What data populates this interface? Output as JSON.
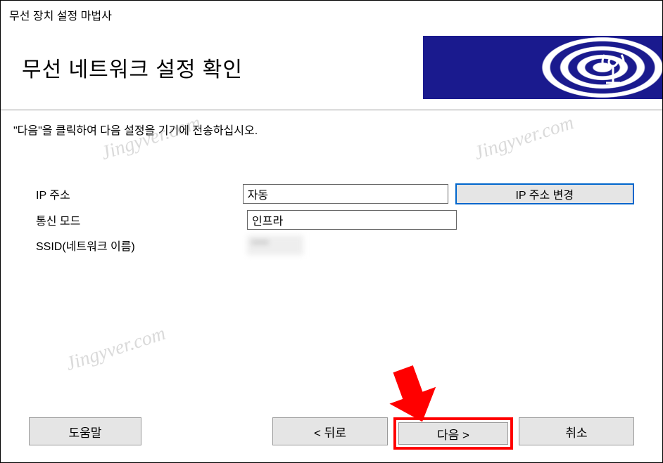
{
  "window": {
    "title": "무선 장치 설정 마법사"
  },
  "header": {
    "title": "무선 네트워크 설정 확인"
  },
  "instruction": "\"다음\"을 클릭하여 다음 설정을 기기에 전송하십시오.",
  "form": {
    "ip_label": "IP 주소",
    "ip_value": "자동",
    "change_ip_button": "IP 주소 변경",
    "mode_label": "통신 모드",
    "mode_value": "인프라",
    "ssid_label": "SSID(네트워크 이름)",
    "ssid_value": "****"
  },
  "buttons": {
    "help": "도움말",
    "back": "< 뒤로",
    "next": "다음 >",
    "cancel": "취소"
  },
  "watermark": "Jingyver.com"
}
